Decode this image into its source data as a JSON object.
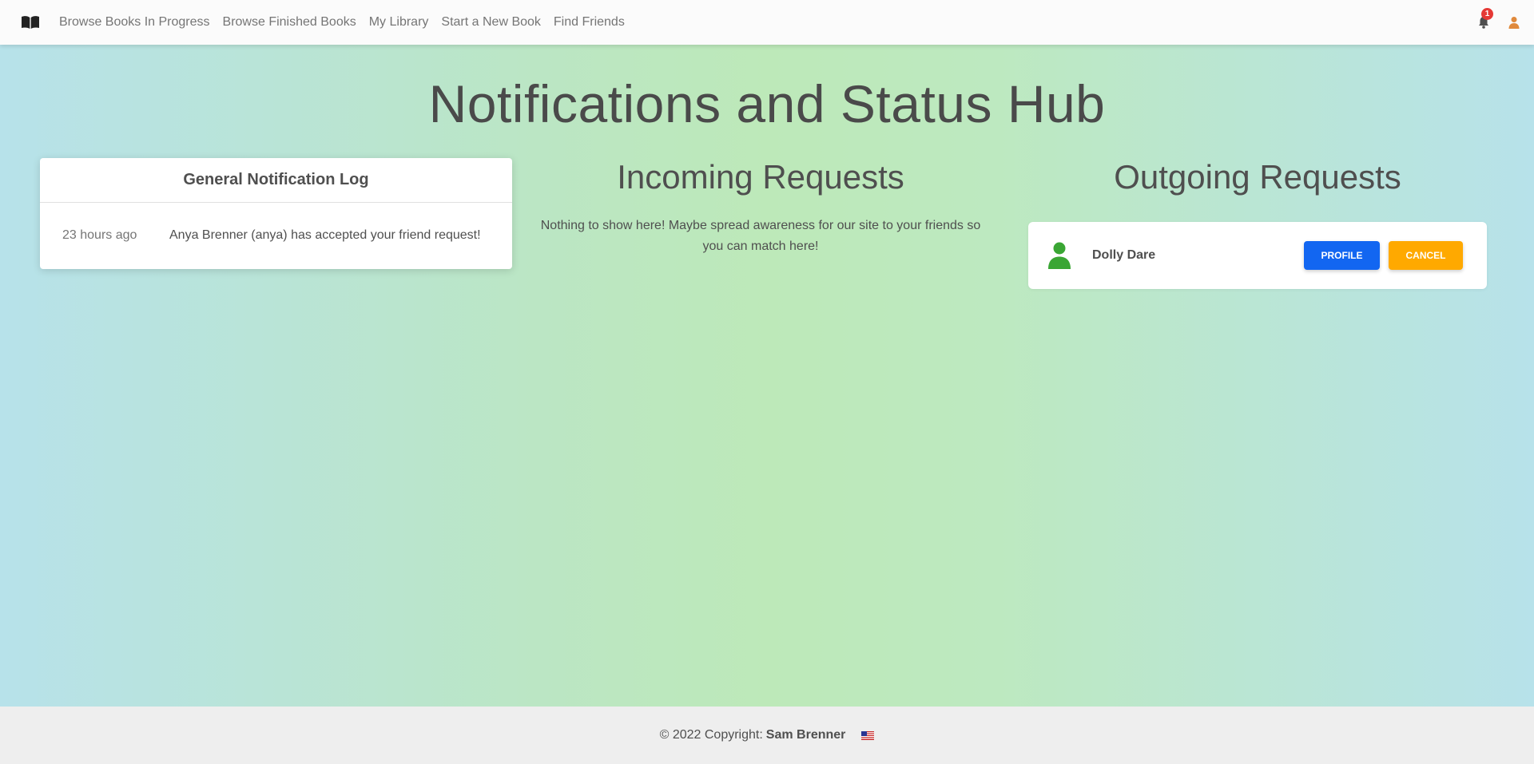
{
  "navbar": {
    "brand_icon": "open-book-icon",
    "links": [
      "Browse Books In Progress",
      "Browse Finished Books",
      "My Library",
      "Start a New Book",
      "Find Friends"
    ],
    "notification_count": "1",
    "notification_icon": "bell-icon",
    "user_icon": "user-icon",
    "user_icon_color": "#e08a3c"
  },
  "page": {
    "title": "Notifications and Status Hub"
  },
  "notification_log": {
    "header": "General Notification Log",
    "items": [
      {
        "time": "23 hours ago",
        "message": "Anya Brenner (anya) has accepted your friend request!"
      }
    ]
  },
  "incoming": {
    "title": "Incoming Requests",
    "empty_message": "Nothing to show here! Maybe spread awareness for our site to your friends so you can match here!"
  },
  "outgoing": {
    "title": "Outgoing Requests",
    "requests": [
      {
        "name": "Dolly Dare",
        "avatar_icon": "person-icon",
        "avatar_color": "#3aa634",
        "profile_label": "PROFILE",
        "cancel_label": "CANCEL"
      }
    ]
  },
  "colors": {
    "primary": "#1266f1",
    "warning": "#ffa900",
    "badge": "#e53935"
  },
  "footer": {
    "copyright": "© 2022 Copyright:",
    "author": "Sam Brenner",
    "flag_icon": "us-flag-icon"
  }
}
